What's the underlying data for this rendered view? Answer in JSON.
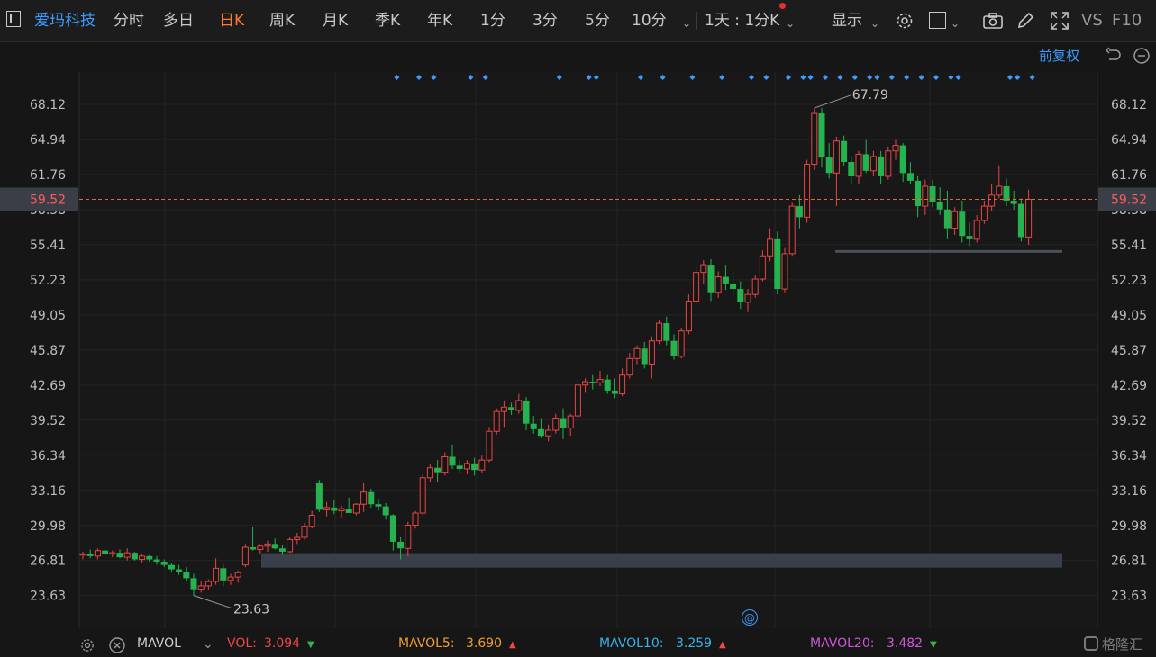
{
  "toolbar": {
    "stock_name": "爱玛科技",
    "tabs": [
      "分时",
      "多日",
      "日K",
      "周K",
      "月K",
      "季K",
      "年K",
      "1分",
      "3分",
      "5分",
      "10分"
    ],
    "active_tab": "日K",
    "period_select": "1天 : 1分K",
    "display_label": "显示",
    "vs_label": "VS",
    "f10_label": "F10"
  },
  "adjust_label": "前复权",
  "price_axis": [
    "68.12",
    "64.94",
    "61.76",
    "58.58",
    "55.41",
    "52.23",
    "49.05",
    "45.87",
    "42.69",
    "39.52",
    "36.34",
    "33.16",
    "29.98",
    "26.81",
    "23.63"
  ],
  "current_price": "59.52",
  "colors": {
    "up": "#e84545",
    "down": "#25b34f",
    "bg": "#161616",
    "grid": "#262626",
    "accent": "#3d9bff",
    "active": "#ff7a2e"
  },
  "chart_data": {
    "type": "candlestick",
    "ylim": [
      21.5,
      69.5
    ],
    "ticks": [
      68.12,
      64.94,
      61.76,
      58.58,
      55.41,
      52.23,
      49.05,
      45.87,
      42.69,
      39.52,
      36.34,
      33.16,
      29.98,
      26.81,
      23.63
    ],
    "current_price": 59.52,
    "high_label": "67.79",
    "low_label": "23.63",
    "high_price": 67.79,
    "low_price": 23.63,
    "ohlc": [
      [
        27.3,
        27.6,
        26.9,
        27.4
      ],
      [
        27.4,
        27.8,
        27.0,
        27.2
      ],
      [
        27.2,
        27.9,
        26.9,
        27.7
      ],
      [
        27.7,
        27.9,
        27.3,
        27.4
      ],
      [
        27.4,
        27.7,
        27.1,
        27.5
      ],
      [
        27.5,
        27.8,
        27.0,
        27.1
      ],
      [
        27.1,
        27.9,
        26.8,
        27.5
      ],
      [
        27.5,
        27.6,
        26.8,
        26.9
      ],
      [
        26.9,
        27.4,
        26.6,
        27.2
      ],
      [
        27.2,
        27.3,
        26.7,
        26.9
      ],
      [
        26.9,
        27.2,
        26.4,
        26.7
      ],
      [
        26.7,
        26.9,
        26.2,
        26.4
      ],
      [
        26.4,
        26.6,
        25.8,
        26.0
      ],
      [
        26.0,
        26.4,
        25.5,
        25.8
      ],
      [
        25.8,
        26.2,
        24.9,
        25.2
      ],
      [
        25.2,
        25.6,
        23.63,
        24.2
      ],
      [
        24.2,
        24.9,
        23.9,
        24.5
      ],
      [
        24.5,
        25.1,
        24.1,
        24.9
      ],
      [
        24.9,
        27.0,
        24.6,
        26.1
      ],
      [
        26.1,
        26.5,
        24.5,
        25.0
      ],
      [
        25.0,
        25.6,
        24.6,
        25.3
      ],
      [
        25.3,
        25.9,
        24.8,
        25.7
      ],
      [
        26.4,
        28.3,
        26.2,
        28.0
      ],
      [
        28.0,
        29.8,
        27.7,
        27.8
      ],
      [
        27.8,
        28.3,
        27.4,
        28.1
      ],
      [
        28.1,
        28.6,
        27.6,
        28.3
      ],
      [
        28.3,
        28.8,
        27.8,
        27.9
      ],
      [
        27.9,
        28.2,
        27.3,
        27.6
      ],
      [
        27.6,
        28.9,
        27.5,
        28.7
      ],
      [
        28.7,
        29.3,
        28.3,
        28.9
      ],
      [
        28.9,
        30.2,
        28.7,
        29.9
      ],
      [
        29.9,
        31.3,
        29.7,
        30.9
      ],
      [
        33.8,
        34.1,
        31.2,
        31.4
      ],
      [
        31.4,
        32.1,
        30.8,
        31.6
      ],
      [
        31.6,
        32.3,
        31.0,
        31.3
      ],
      [
        31.3,
        31.8,
        30.7,
        31.5
      ],
      [
        31.5,
        32.5,
        31.3,
        31.1
      ],
      [
        31.1,
        32.0,
        30.9,
        31.9
      ],
      [
        31.9,
        33.8,
        31.2,
        33.0
      ],
      [
        33.0,
        33.3,
        31.6,
        31.9
      ],
      [
        31.9,
        32.4,
        31.3,
        31.7
      ],
      [
        31.7,
        32.0,
        30.5,
        30.9
      ],
      [
        30.9,
        31.0,
        27.7,
        28.5
      ],
      [
        28.5,
        28.9,
        26.9,
        27.9
      ],
      [
        27.9,
        30.3,
        27.2,
        30.0
      ],
      [
        30.0,
        31.3,
        29.7,
        31.1
      ],
      [
        31.1,
        34.6,
        30.9,
        34.3
      ],
      [
        34.3,
        35.6,
        33.9,
        35.2
      ],
      [
        35.2,
        35.9,
        33.9,
        34.8
      ],
      [
        34.8,
        36.6,
        34.5,
        36.2
      ],
      [
        36.2,
        37.3,
        35.1,
        35.4
      ],
      [
        35.4,
        35.9,
        34.7,
        35.1
      ],
      [
        35.1,
        35.9,
        34.6,
        35.6
      ],
      [
        35.6,
        36.1,
        34.5,
        35.0
      ],
      [
        35.0,
        36.3,
        34.7,
        35.9
      ],
      [
        35.9,
        38.9,
        35.7,
        38.5
      ],
      [
        38.5,
        40.6,
        38.2,
        40.3
      ],
      [
        40.3,
        41.3,
        38.9,
        40.7
      ],
      [
        40.7,
        41.1,
        40.0,
        40.4
      ],
      [
        40.4,
        41.9,
        40.1,
        41.3
      ],
      [
        41.3,
        41.6,
        38.6,
        39.2
      ],
      [
        39.2,
        39.9,
        38.3,
        38.7
      ],
      [
        38.7,
        39.7,
        37.9,
        38.1
      ],
      [
        38.1,
        39.1,
        37.6,
        38.6
      ],
      [
        38.6,
        40.1,
        38.3,
        39.7
      ],
      [
        39.7,
        40.6,
        37.8,
        38.8
      ],
      [
        38.8,
        40.1,
        38.1,
        39.9
      ],
      [
        39.9,
        43.2,
        39.7,
        42.7
      ],
      [
        42.7,
        43.3,
        42.0,
        43.0
      ],
      [
        43.0,
        43.6,
        42.3,
        42.9
      ],
      [
        42.9,
        44.0,
        42.6,
        43.2
      ],
      [
        43.2,
        43.6,
        41.9,
        42.2
      ],
      [
        42.2,
        43.3,
        41.5,
        41.9
      ],
      [
        41.9,
        44.2,
        41.7,
        43.6
      ],
      [
        43.6,
        45.6,
        43.3,
        45.1
      ],
      [
        45.1,
        46.3,
        44.6,
        46.0
      ],
      [
        46.0,
        46.6,
        44.2,
        44.6
      ],
      [
        44.6,
        47.1,
        43.3,
        46.7
      ],
      [
        46.7,
        48.6,
        46.4,
        48.3
      ],
      [
        48.3,
        48.9,
        46.3,
        46.7
      ],
      [
        46.7,
        47.3,
        45.0,
        45.3
      ],
      [
        45.3,
        47.9,
        45.1,
        47.6
      ],
      [
        47.6,
        50.9,
        47.3,
        50.3
      ],
      [
        50.3,
        53.4,
        50.1,
        52.9
      ],
      [
        52.9,
        54.0,
        51.9,
        53.6
      ],
      [
        53.6,
        54.1,
        50.3,
        51.1
      ],
      [
        51.1,
        53.0,
        50.6,
        52.5
      ],
      [
        52.5,
        53.6,
        51.3,
        51.9
      ],
      [
        51.9,
        53.1,
        50.6,
        51.4
      ],
      [
        51.4,
        52.1,
        49.6,
        50.2
      ],
      [
        50.2,
        51.4,
        49.3,
        50.9
      ],
      [
        50.9,
        52.7,
        50.6,
        52.3
      ],
      [
        52.3,
        54.9,
        52.1,
        54.4
      ],
      [
        54.4,
        56.9,
        53.9,
        55.9
      ],
      [
        55.9,
        56.6,
        50.9,
        51.4
      ],
      [
        51.4,
        55.1,
        51.1,
        54.6
      ],
      [
        54.6,
        59.2,
        54.4,
        58.9
      ],
      [
        58.9,
        59.9,
        56.9,
        57.9
      ],
      [
        57.9,
        63.1,
        57.4,
        62.7
      ],
      [
        62.7,
        67.79,
        62.2,
        67.3
      ],
      [
        67.3,
        67.8,
        62.4,
        63.3
      ],
      [
        63.3,
        64.6,
        61.4,
        61.9
      ],
      [
        61.9,
        65.2,
        58.9,
        64.8
      ],
      [
        64.8,
        65.3,
        62.6,
        62.9
      ],
      [
        62.9,
        63.4,
        60.9,
        61.6
      ],
      [
        61.6,
        63.9,
        60.9,
        63.6
      ],
      [
        63.6,
        64.9,
        61.9,
        62.1
      ],
      [
        62.1,
        63.9,
        61.6,
        63.4
      ],
      [
        63.4,
        63.9,
        60.9,
        61.6
      ],
      [
        61.6,
        64.3,
        61.3,
        63.9
      ],
      [
        63.9,
        64.9,
        63.1,
        64.4
      ],
      [
        64.4,
        64.6,
        61.1,
        61.9
      ],
      [
        61.9,
        62.9,
        60.9,
        61.2
      ],
      [
        61.2,
        61.6,
        57.9,
        58.9
      ],
      [
        58.9,
        61.3,
        58.1,
        60.7
      ],
      [
        60.7,
        61.3,
        58.8,
        59.3
      ],
      [
        59.3,
        60.6,
        58.1,
        58.6
      ],
      [
        58.6,
        60.3,
        55.9,
        56.9
      ],
      [
        56.9,
        58.8,
        56.3,
        58.4
      ],
      [
        58.4,
        59.4,
        55.6,
        56.2
      ],
      [
        56.2,
        57.4,
        55.3,
        55.9
      ],
      [
        55.9,
        58.1,
        55.6,
        57.6
      ],
      [
        57.6,
        59.4,
        57.3,
        58.9
      ],
      [
        58.9,
        60.9,
        58.5,
        59.9
      ],
      [
        59.9,
        62.6,
        59.6,
        60.7
      ],
      [
        60.7,
        61.4,
        58.9,
        59.4
      ],
      [
        59.4,
        60.3,
        58.6,
        59.1
      ],
      [
        59.1,
        59.6,
        55.7,
        56.1
      ],
      [
        56.1,
        60.4,
        55.4,
        59.52
      ]
    ],
    "ranges": [
      {
        "from_index": 0,
        "to_index": 28,
        "price": 26.81
      },
      {
        "from_index": 0,
        "to_index": 17,
        "price": 54.8
      }
    ],
    "marker_count": 31
  },
  "volume_bar": {
    "indicator": "MAVOL",
    "vol_label": "VOL:",
    "vol_value": "3.094",
    "mavol5_label": "MAVOL5:",
    "mavol5_value": "3.690",
    "mavol10_label": "MAVOL10:",
    "mavol10_value": "3.259",
    "mavol20_label": "MAVOL20:",
    "mavol20_value": "3.482"
  },
  "watermark": "格隆汇"
}
